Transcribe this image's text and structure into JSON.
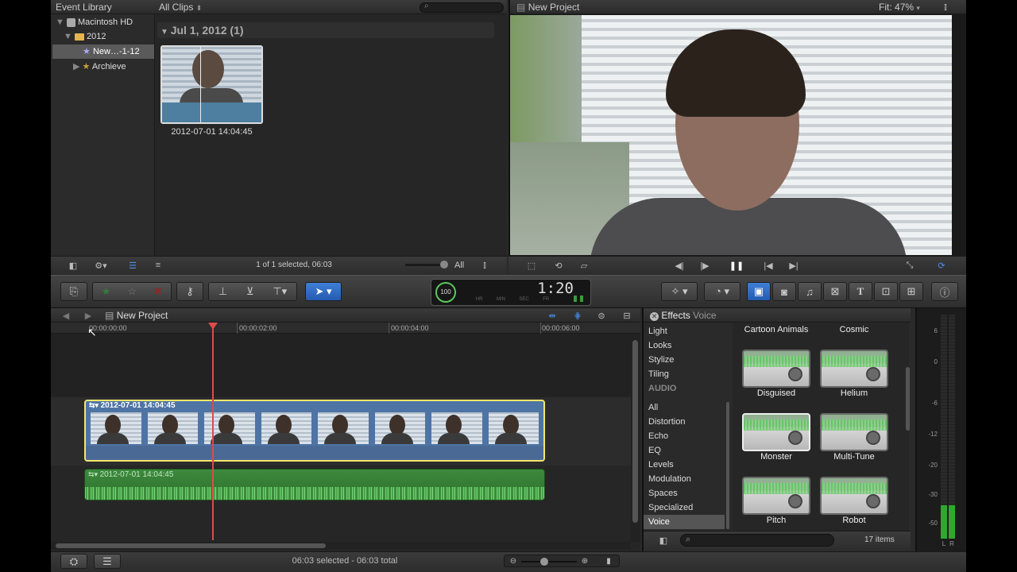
{
  "event_library": {
    "title": "Event Library",
    "items": [
      {
        "label": "Macintosh HD"
      },
      {
        "label": "2012"
      },
      {
        "label": "New…-1-12"
      },
      {
        "label": "Archieve"
      }
    ]
  },
  "browser": {
    "filter": "All Clips",
    "group_header": "Jul 1, 2012  (1)",
    "clip_name": "2012-07-01 14:04:45",
    "status": "1 of 1 selected, 06:03",
    "all_label": "All"
  },
  "viewer": {
    "title": "New Project",
    "fit_label": "Fit:",
    "fit_value": "47%"
  },
  "dashboard": {
    "percent": "100",
    "timecode": "1:20",
    "units": [
      "HR",
      "MIN",
      "SEC",
      "FR"
    ]
  },
  "timeline": {
    "project_name": "New Project",
    "ruler": [
      "00:00:00:00",
      "00:00:02:00",
      "00:00:04:00",
      "00:00:06:00"
    ],
    "video_clip_name": "2012-07-01 14:04:45",
    "audio_clip_name": "2012-07-01 14:04:45",
    "status": "06:03 selected - 06:03 total"
  },
  "effects": {
    "title": "Effects",
    "subtitle": "Voice",
    "categories": [
      "Light",
      "Looks",
      "Stylize",
      "Tiling"
    ],
    "audio_header": "AUDIO",
    "audio_categories": [
      "All",
      "Distortion",
      "Echo",
      "EQ",
      "Levels",
      "Modulation",
      "Spaces",
      "Specialized",
      "Voice"
    ],
    "selected_category": "Voice",
    "top_labels": [
      "Cartoon Animals",
      "Cosmic"
    ],
    "tiles": [
      {
        "label": "Disguised"
      },
      {
        "label": "Helium"
      },
      {
        "label": "Monster"
      },
      {
        "label": "Multi-Tune"
      },
      {
        "label": "Pitch"
      },
      {
        "label": "Robot"
      }
    ],
    "count": "17 items"
  },
  "meters": {
    "scale": [
      "6",
      "0",
      "-6",
      "-12",
      "-20",
      "-30",
      "-50"
    ],
    "channels": [
      "L",
      "R"
    ]
  }
}
